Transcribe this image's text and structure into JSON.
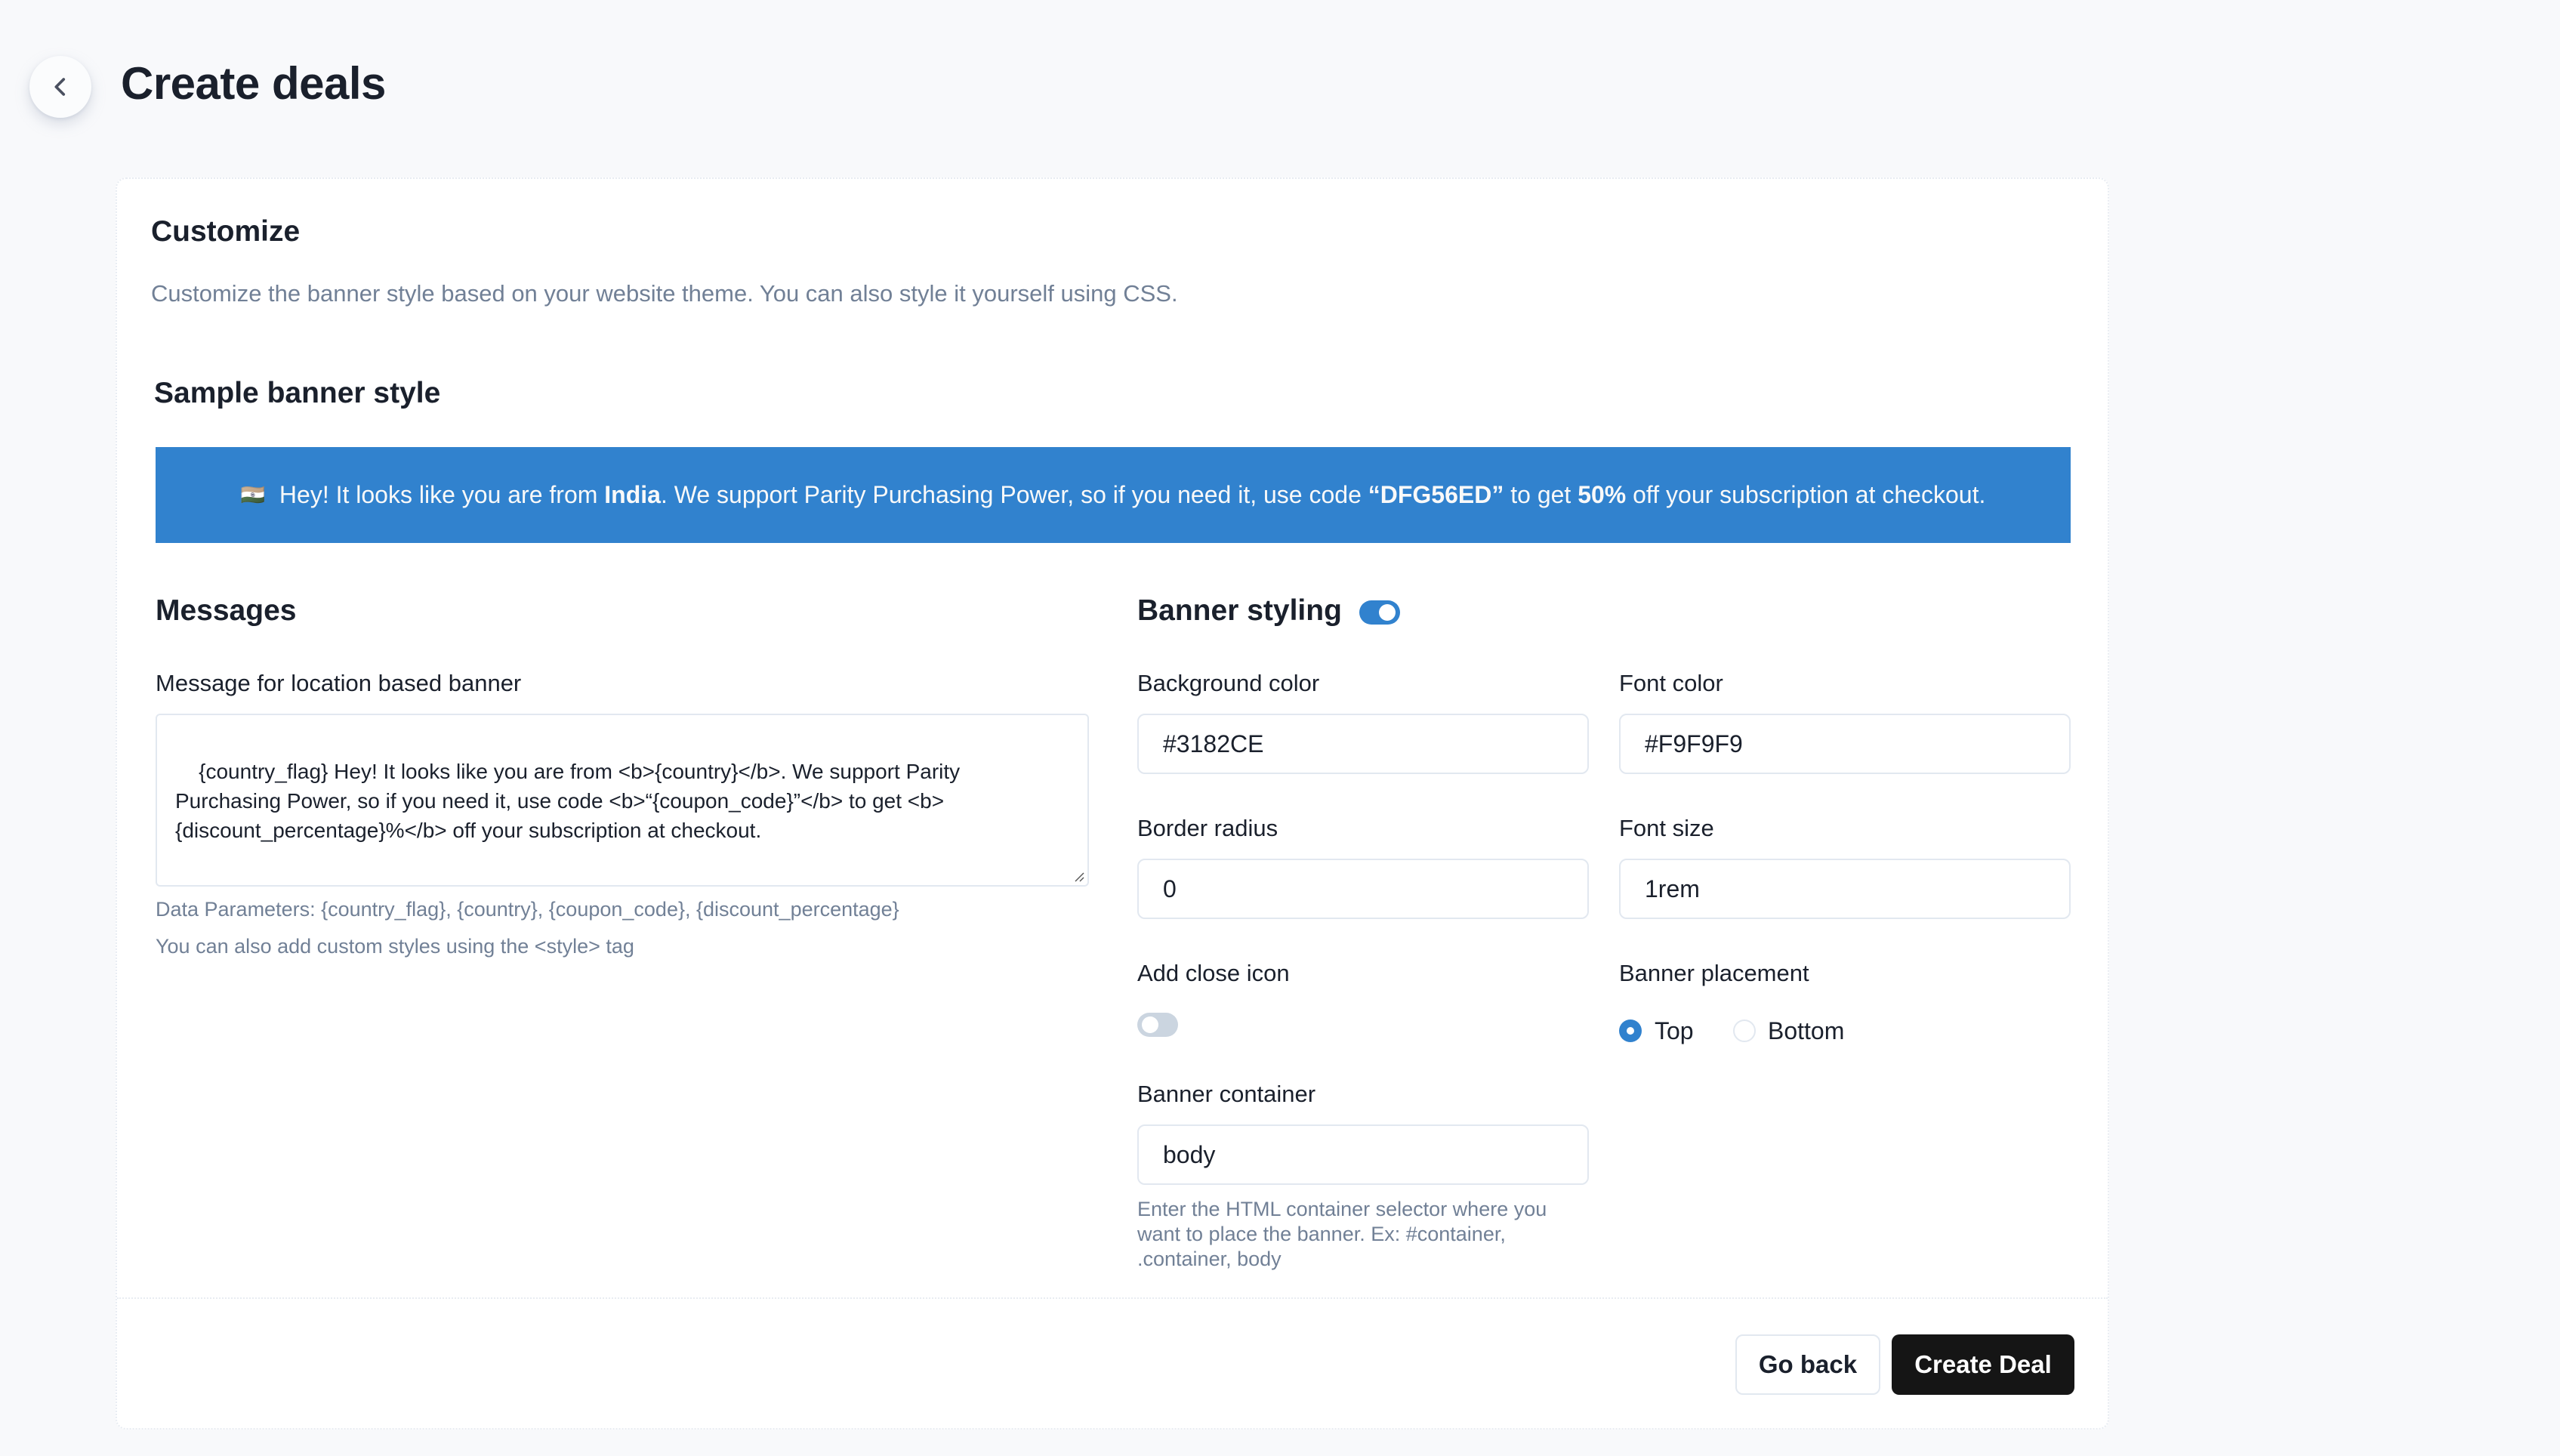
{
  "header": {
    "title": "Create deals",
    "back_icon": "chevron-left-icon"
  },
  "customize": {
    "heading": "Customize",
    "description": "Customize the banner style based on your website theme. You can also style it yourself using CSS."
  },
  "sample_banner": {
    "heading": "Sample banner style",
    "flag": "🇮🇳",
    "text_1": " Hey! It looks like you are from ",
    "country": "India",
    "text_2": ". We support Parity Purchasing Power, so if you need it, use code ",
    "code": "“DFG56ED”",
    "text_3": " to get ",
    "discount": "50%",
    "text_4": " off your subscription at checkout.",
    "background_color": "#3182CE",
    "font_color": "#F9F9F9"
  },
  "messages": {
    "heading": "Messages",
    "message_label": "Message for location based banner",
    "message_value": "{country_flag} Hey! It looks like you are from <b>{country}</b>. We support Parity Purchasing Power, so if you need it, use code <b>“{coupon_code}”</b> to get <b>{discount_percentage}%</b> off your subscription at checkout.",
    "data_parameters": "Data Parameters: {country_flag}, {country}, {coupon_code}, {discount_percentage}",
    "custom_styles_hint": "You can also add custom styles using the <style> tag"
  },
  "banner_styling": {
    "heading": "Banner styling",
    "enabled": true,
    "background_color_label": "Background color",
    "background_color_value": "#3182CE",
    "font_color_label": "Font color",
    "font_color_value": "#F9F9F9",
    "border_radius_label": "Border radius",
    "border_radius_value": "0",
    "font_size_label": "Font size",
    "font_size_value": "1rem",
    "close_icon_label": "Add close icon",
    "close_icon_enabled": false,
    "placement_label": "Banner placement",
    "placement_options": [
      "Top",
      "Bottom"
    ],
    "placement_selected": "Top",
    "container_label": "Banner container",
    "container_value": "body",
    "container_hint": "Enter the HTML container selector where you want to place the banner. Ex: #container, .container, body"
  },
  "footer": {
    "go_back_label": "Go back",
    "create_label": "Create Deal"
  },
  "colors": {
    "accent": "#3182CE",
    "primary_button": "#151515",
    "page_bg": "#F8F9FB"
  }
}
